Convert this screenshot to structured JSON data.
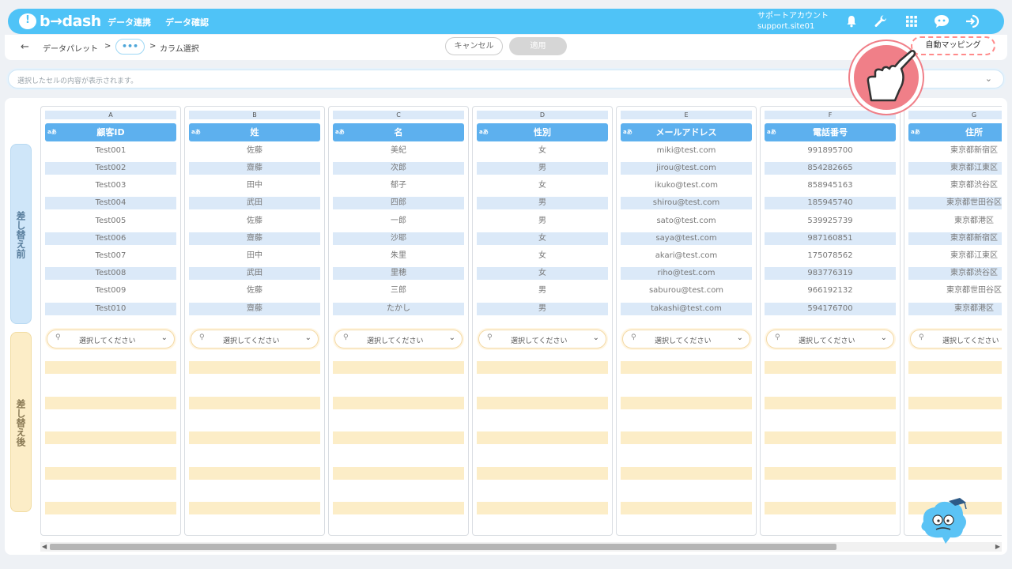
{
  "topbar": {
    "logo": "b→dash",
    "nav": [
      "データ連携",
      "データ確認"
    ],
    "account_line1": "サポートアカウント",
    "account_line2": "support.site01",
    "icons": [
      "bell-icon",
      "wrench-icon",
      "grid-icon",
      "chat-bot-icon",
      "logout-icon"
    ]
  },
  "breadcrumb": {
    "back": "←",
    "first": "データパレット",
    "sep": ">",
    "dots": "•••",
    "sep2": ">",
    "current": "カラム選択"
  },
  "actions": {
    "cancel": "キャンセル",
    "apply": "適用",
    "auto_mapping": "自動マッピング"
  },
  "cellbar": {
    "placeholder": "選択したセルの内容が表示されます。"
  },
  "side": {
    "before": "差し替え前",
    "after": "差し替え後"
  },
  "select_placeholder": "選択してください",
  "columns": [
    {
      "letter": "A",
      "type": "aあ",
      "header": "顧客ID",
      "values": [
        "Test001",
        "Test002",
        "Test003",
        "Test004",
        "Test005",
        "Test006",
        "Test007",
        "Test008",
        "Test009",
        "Test010"
      ]
    },
    {
      "letter": "B",
      "type": "aあ",
      "header": "姓",
      "values": [
        "佐藤",
        "齋藤",
        "田中",
        "武田",
        "佐藤",
        "齋藤",
        "田中",
        "武田",
        "佐藤",
        "齋藤"
      ]
    },
    {
      "letter": "C",
      "type": "aあ",
      "header": "名",
      "values": [
        "美紀",
        "次郎",
        "郁子",
        "四郎",
        "一郎",
        "沙耶",
        "朱里",
        "里穂",
        "三郎",
        "たかし"
      ]
    },
    {
      "letter": "D",
      "type": "aあ",
      "header": "性別",
      "values": [
        "女",
        "男",
        "女",
        "男",
        "男",
        "女",
        "女",
        "女",
        "男",
        "男"
      ]
    },
    {
      "letter": "E",
      "type": "aあ",
      "header": "メールアドレス",
      "values": [
        "miki@test.com",
        "jirou@test.com",
        "ikuko@test.com",
        "shirou@test.com",
        "sato@test.com",
        "saya@test.com",
        "akari@test.com",
        "riho@test.com",
        "saburou@test.com",
        "takashi@test.com"
      ]
    },
    {
      "letter": "F",
      "type": "aあ",
      "header": "電話番号",
      "values": [
        "991895700",
        "854282665",
        "858945163",
        "185945740",
        "539925739",
        "987160851",
        "175078562",
        "983776319",
        "966192132",
        "594176700"
      ]
    },
    {
      "letter": "G",
      "type": "aあ",
      "header": "住所",
      "values": [
        "東京都新宿区",
        "東京都江東区",
        "東京都渋谷区",
        "東京都世田谷区",
        "東京都港区",
        "東京都新宿区",
        "東京都江東区",
        "東京都渋谷区",
        "東京都世田谷区",
        "東京都港区"
      ]
    }
  ]
}
